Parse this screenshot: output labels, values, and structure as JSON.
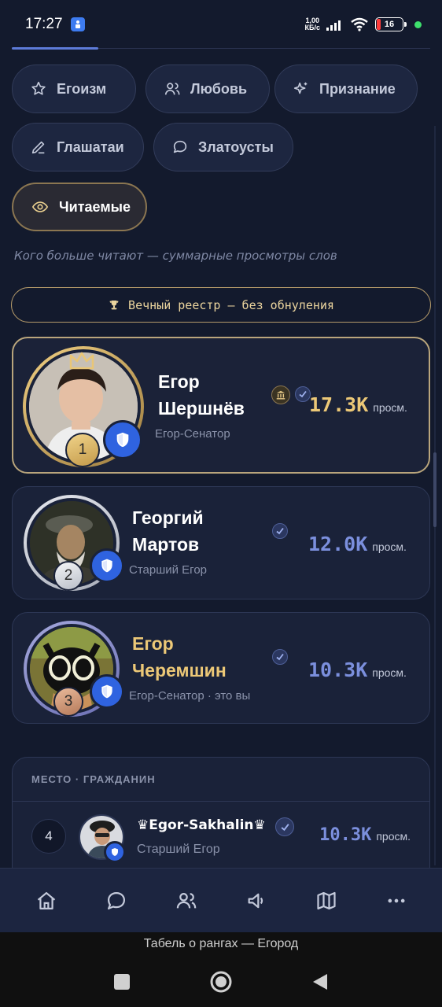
{
  "status_bar": {
    "time": "17:27",
    "net_speed_value": "1,00",
    "net_speed_unit": "КБ/с",
    "battery": "16"
  },
  "tabs": [
    {
      "label": "Егоизм",
      "icon": "star-icon"
    },
    {
      "label": "Любовь",
      "icon": "users-icon"
    },
    {
      "label": "Признание",
      "icon": "sparkle-icon"
    },
    {
      "label": "Глашатаи",
      "icon": "pen-icon"
    },
    {
      "label": "Златоусты",
      "icon": "chat-bubble-icon"
    },
    {
      "label": "Читаемые",
      "icon": "eye-icon",
      "active": true
    }
  ],
  "subtitle": "Кого больше читают — суммарные просмотры слов",
  "registry_banner": "Вечный реестр — без обнуления",
  "leaders": [
    {
      "rank": "1",
      "name_line1": "Егор",
      "name_line2": "Шершнёв",
      "role": "Егор-Сенатор",
      "views": "17.3K",
      "views_unit": "просм."
    },
    {
      "rank": "2",
      "name_line1": "Георгий",
      "name_line2": "Мартов",
      "role": "Старший Егор",
      "views": "12.0K",
      "views_unit": "просм."
    },
    {
      "rank": "3",
      "name_line1": "Егор",
      "name_line2": "Черемшин",
      "role": "Егор-Сенатор · это вы",
      "views": "10.3K",
      "views_unit": "просм."
    }
  ],
  "table": {
    "header": "МЕСТО · ГРАЖДАНИН",
    "rows": [
      {
        "rank": "4",
        "name": "♛Egor-Sakhalin♛",
        "role": "Старший Егор",
        "views": "10.3K",
        "views_unit": "просм."
      }
    ]
  },
  "bottom_nav": [
    "home-icon",
    "chat-icon",
    "people-icon",
    "megaphone-icon",
    "map-icon",
    "more-icon"
  ],
  "footer_label": "Табель о рангах — Егород",
  "colors": {
    "background": "#131a2d",
    "gold": "#ecc877",
    "blue_accent": "#7b8fdd",
    "shield_blue": "#2f63e0"
  }
}
